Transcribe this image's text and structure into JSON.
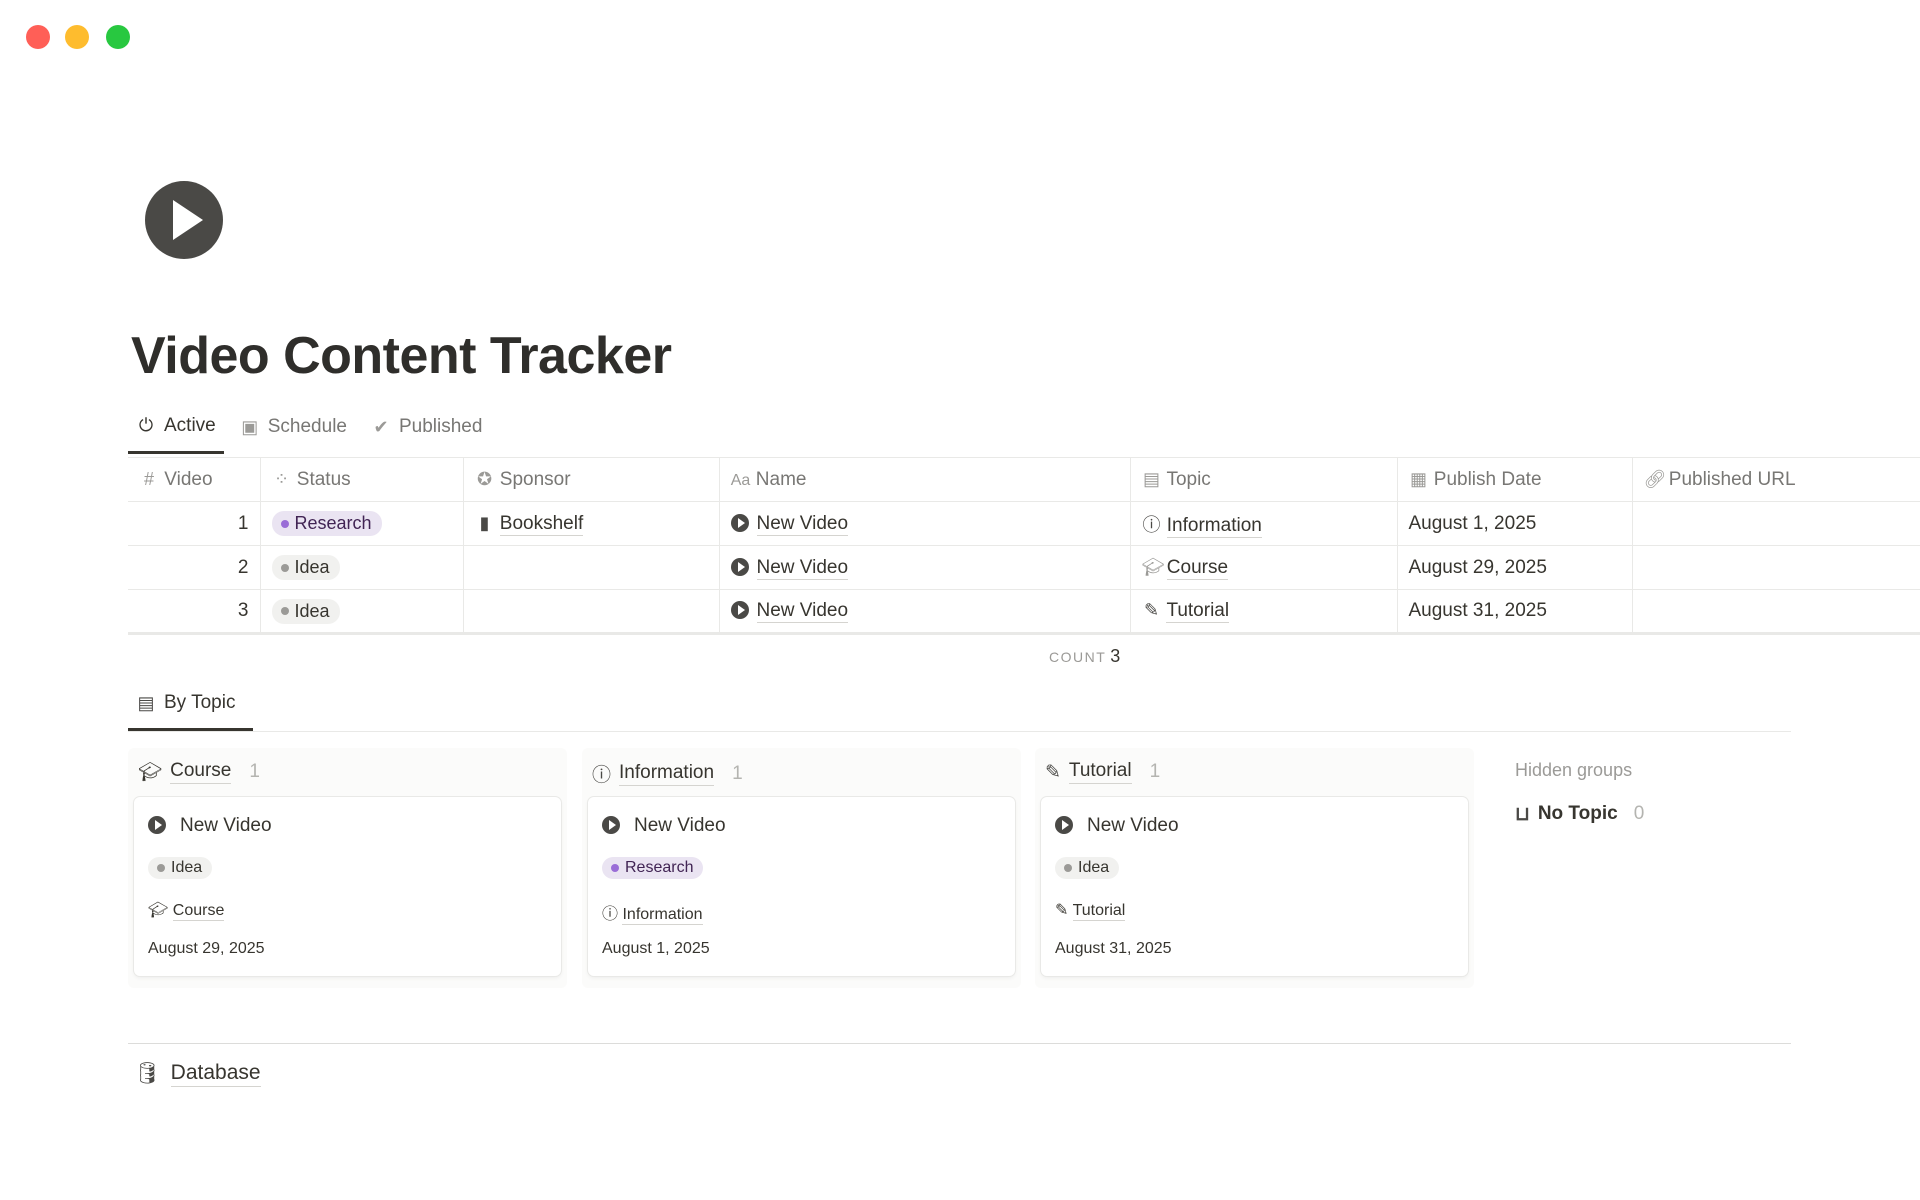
{
  "window": {
    "controls": {
      "close": "#ff5f57",
      "minimize": "#febc2e",
      "zoom": "#28c840"
    }
  },
  "page": {
    "icon": "play-circle-icon",
    "title": "Video Content Tracker"
  },
  "views": [
    {
      "label": "Active",
      "icon": "power-icon"
    },
    {
      "label": "Schedule",
      "icon": "calendar-icon"
    },
    {
      "label": "Published",
      "icon": "check-circle-icon"
    }
  ],
  "table": {
    "columns": [
      "Video",
      "Status",
      "Sponsor",
      "Name",
      "Topic",
      "Publish Date",
      "Published URL"
    ],
    "rows": [
      {
        "video": "1",
        "status": "Research",
        "sponsor": "Bookshelf",
        "name": "New Video",
        "topic": "Information",
        "date": "August 1, 2025",
        "url": ""
      },
      {
        "video": "2",
        "status": "Idea",
        "sponsor": "",
        "name": "New Video",
        "topic": "Course",
        "date": "August 29, 2025",
        "url": ""
      },
      {
        "video": "3",
        "status": "Idea",
        "sponsor": "",
        "name": "New Video",
        "topic": "Tutorial",
        "date": "August 31, 2025",
        "url": ""
      }
    ],
    "count_label": "COUNT",
    "count": "3"
  },
  "board": {
    "tab": "By Topic",
    "groups": [
      {
        "name": "Course",
        "count": "1",
        "card": {
          "title": "New Video",
          "status": "Idea",
          "topic": "Course",
          "date": "August 29, 2025"
        }
      },
      {
        "name": "Information",
        "count": "1",
        "card": {
          "title": "New Video",
          "status": "Research",
          "topic": "Information",
          "date": "August 1, 2025"
        }
      },
      {
        "name": "Tutorial",
        "count": "1",
        "card": {
          "title": "New Video",
          "status": "Idea",
          "topic": "Tutorial",
          "date": "August 31, 2025"
        }
      }
    ],
    "hidden_label": "Hidden groups",
    "hidden": [
      {
        "name": "No Topic",
        "count": "0"
      }
    ]
  },
  "database": {
    "label": "Database"
  }
}
